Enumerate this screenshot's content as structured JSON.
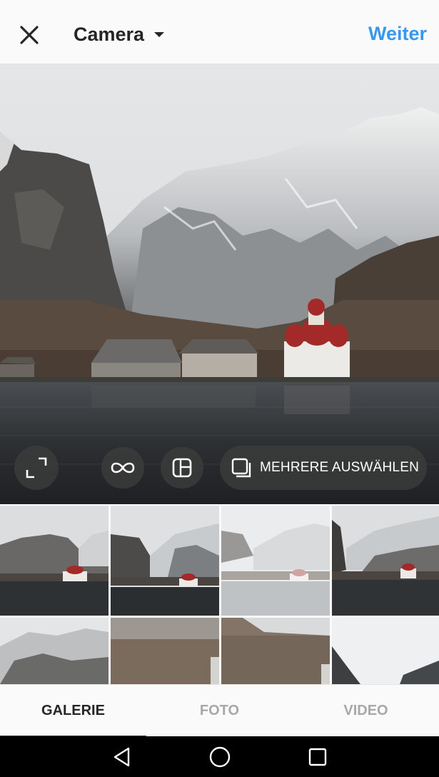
{
  "header": {
    "title": "Camera",
    "next_label": "Weiter"
  },
  "toolbar": {
    "multi_select_label": "MEHRERE AUSWÄHLEN"
  },
  "tabs": [
    {
      "label": "GALERIE",
      "active": true
    },
    {
      "label": "FOTO",
      "active": false
    },
    {
      "label": "VIDEO",
      "active": false
    }
  ],
  "icons": {
    "close": "close-icon",
    "dropdown": "chevron-down-icon",
    "expand": "expand-icon",
    "boomerang": "infinity-icon",
    "layout": "layout-icon",
    "multi_select": "multi-select-icon",
    "back": "back-triangle-icon",
    "home": "home-circle-icon",
    "recents": "recents-square-icon"
  },
  "colors": {
    "accent": "#3897f0",
    "text": "#262626",
    "inactive_text": "#a8a8a8"
  }
}
